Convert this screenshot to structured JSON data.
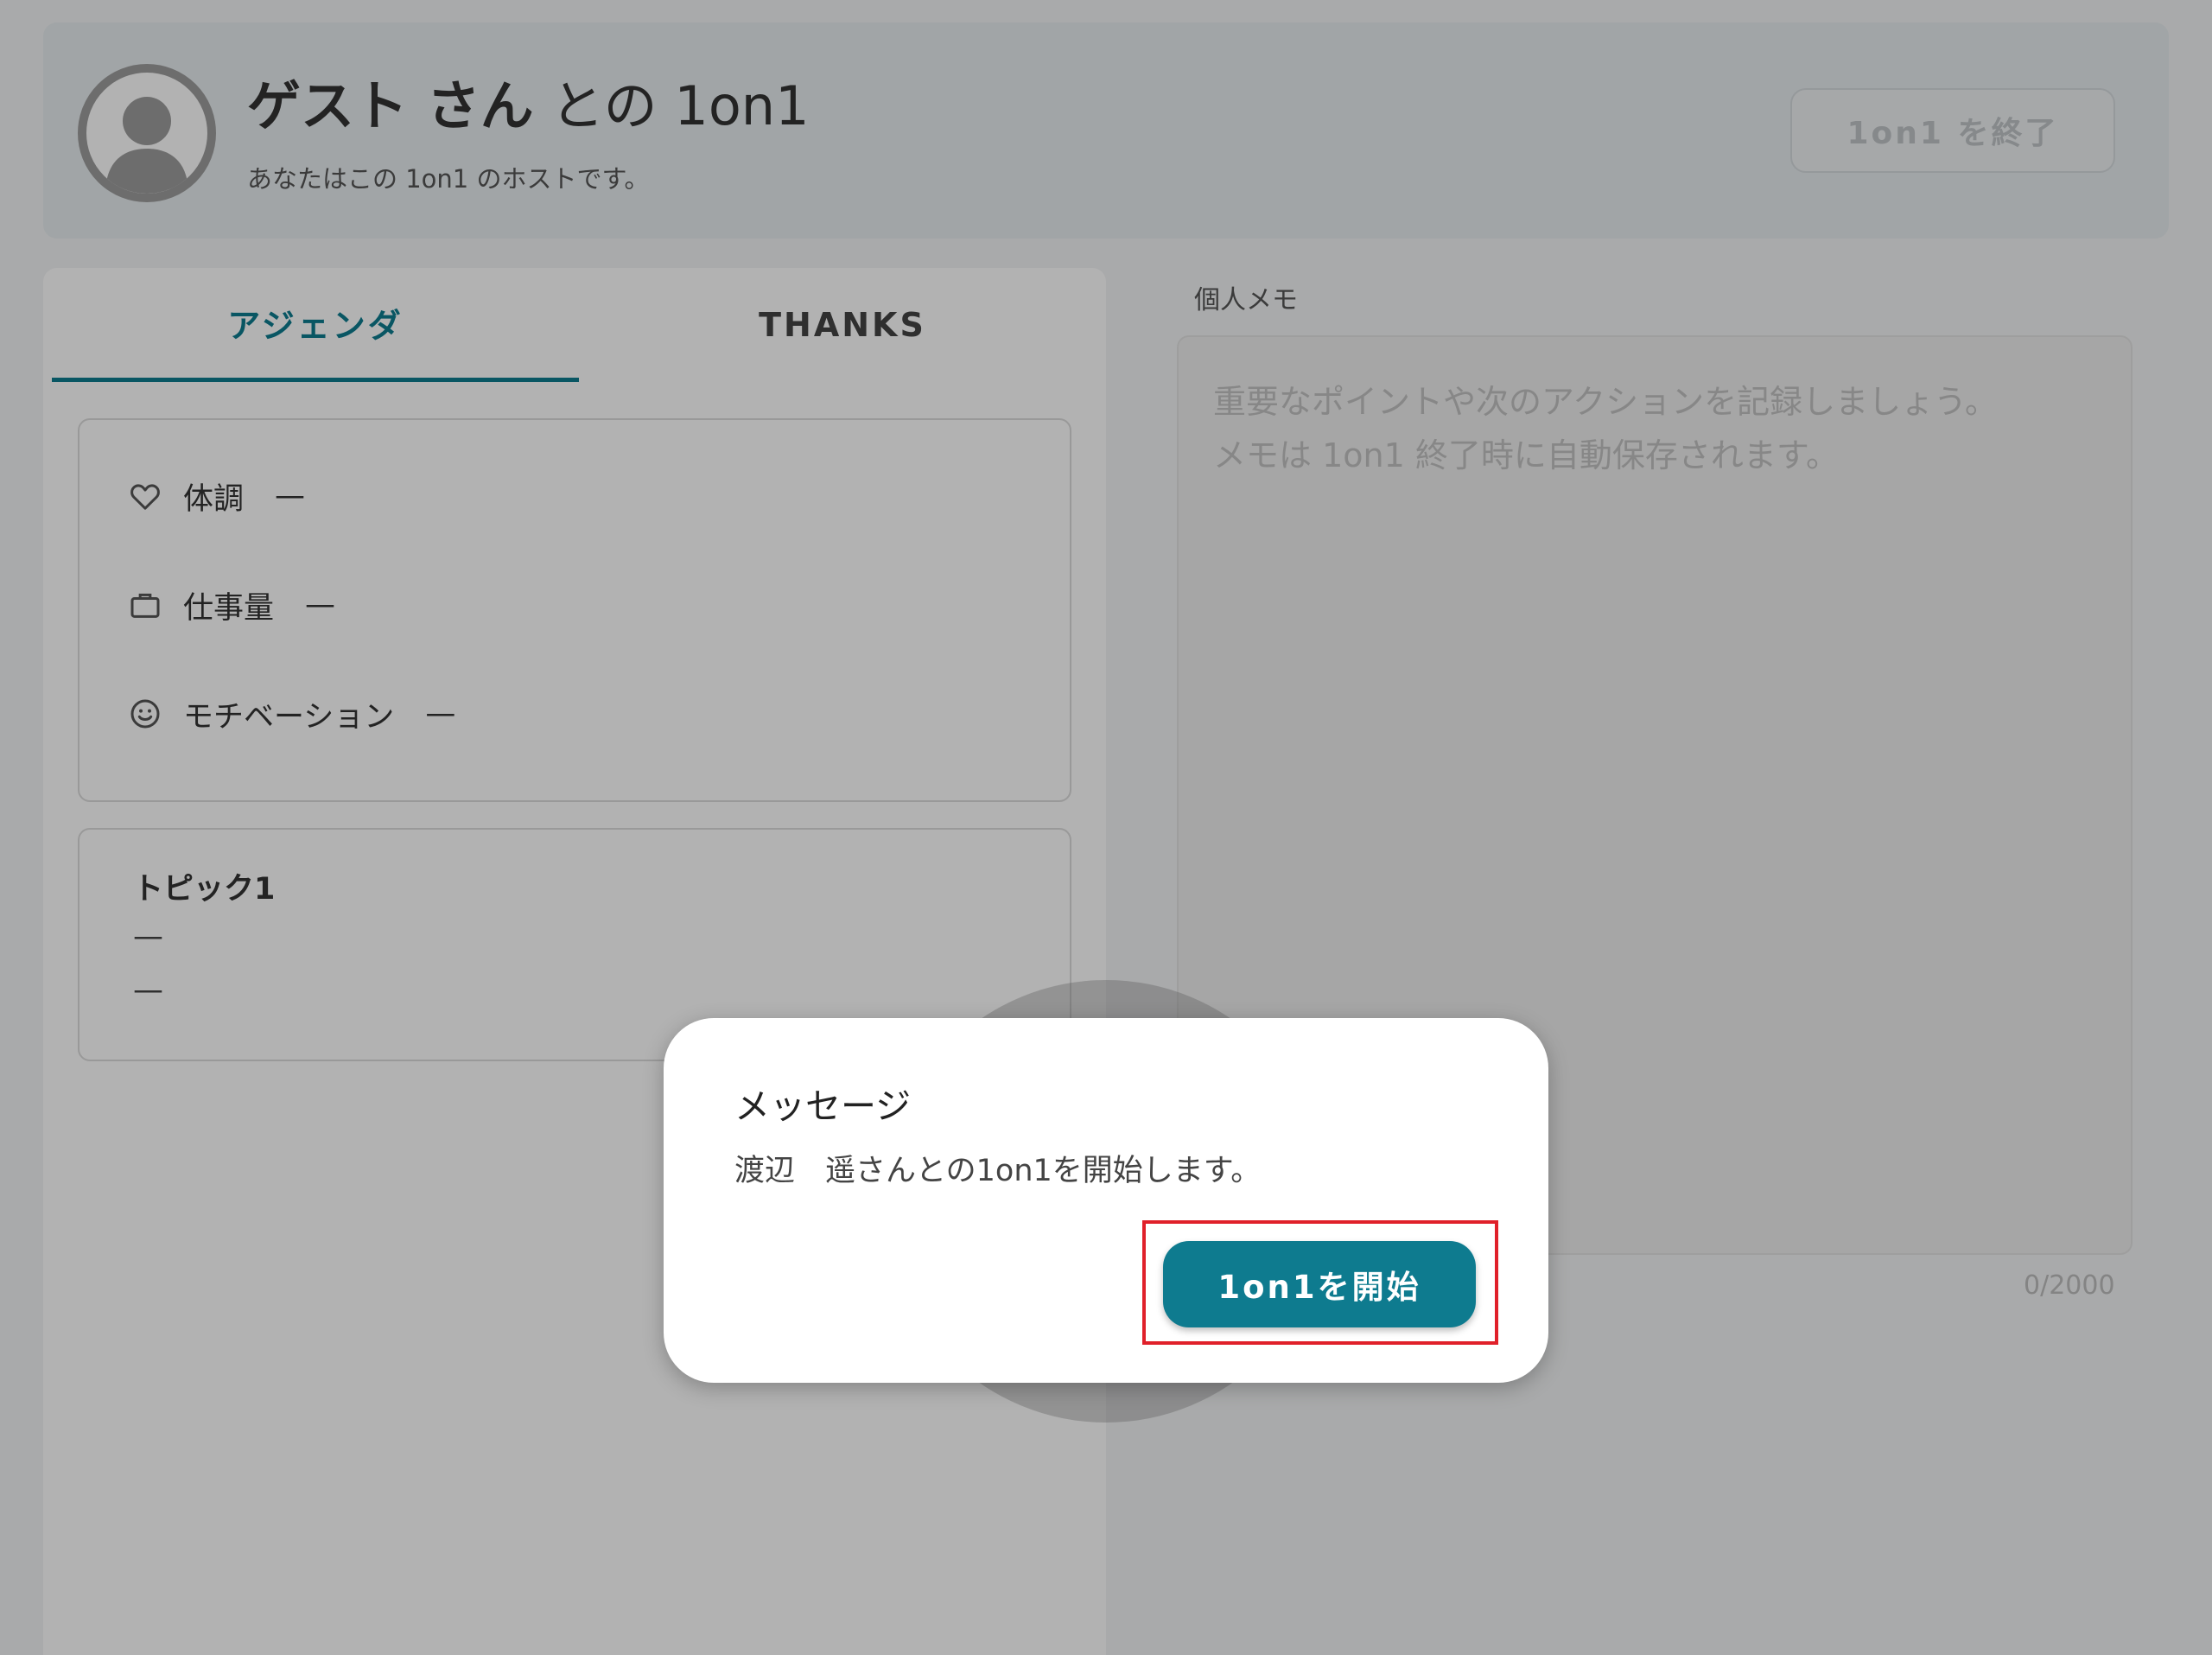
{
  "header": {
    "guest_name": "ゲスト さん",
    "title_suffix": " との 1on1",
    "subtitle": "あなたはこの 1on1 のホストです。",
    "end_button": "1on1 を終了"
  },
  "tabs": [
    {
      "label": "アジェンダ",
      "active": true
    },
    {
      "label": "THANKS",
      "active": false
    }
  ],
  "status": {
    "items": [
      {
        "icon": "heart-icon",
        "label": "体調",
        "value": "—"
      },
      {
        "icon": "briefcase-icon",
        "label": "仕事量",
        "value": "—"
      },
      {
        "icon": "smile-icon",
        "label": "モチベーション",
        "value": "—"
      }
    ]
  },
  "topic": {
    "title": "トピック1",
    "lines": [
      "—",
      "—"
    ]
  },
  "memo": {
    "label": "個人メモ",
    "placeholder": "重要なポイントや次のアクションを記録しましょう。\nメモは 1on1 終了時に自動保存されます。",
    "count": "0/2000"
  },
  "dialog": {
    "title": "メッセージ",
    "message": "渡辺　遥さんとの1on1を開始します。",
    "button": "1on1を開始"
  },
  "colors": {
    "accent": "#0e7b8f",
    "highlight": "#e0202a"
  }
}
